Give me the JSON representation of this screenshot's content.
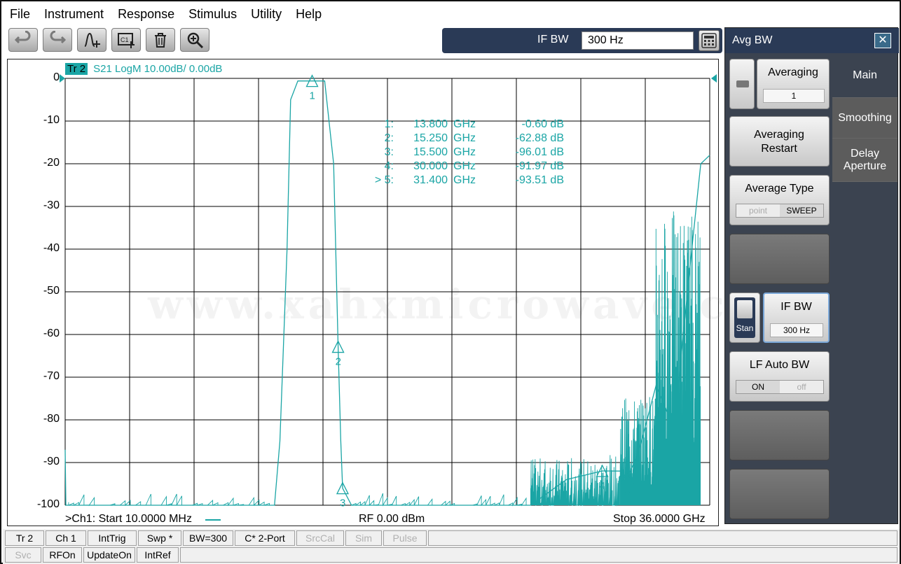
{
  "menu": [
    "File",
    "Instrument",
    "Response",
    "Stimulus",
    "Utility",
    "Help"
  ],
  "toolbar": {
    "ifbw_label": "IF BW",
    "ifbw_value": "300 Hz"
  },
  "plot": {
    "trace_badge": "Tr 2",
    "trace_desc": "S21 LogM 10.00dB/  0.00dB",
    "y_ticks": [
      "0",
      "-10",
      "-20",
      "-30",
      "-40",
      "-50",
      "-60",
      "-70",
      "-80",
      "-90",
      "-100"
    ],
    "markers": [
      {
        "id": "1:",
        "freq": "13.800",
        "unit": "GHz",
        "value": "-0.60 dB"
      },
      {
        "id": "2:",
        "freq": "15.250",
        "unit": "GHz",
        "value": "-62.88 dB"
      },
      {
        "id": "3:",
        "freq": "15.500",
        "unit": "GHz",
        "value": "-96.01 dB"
      },
      {
        "id": "4:",
        "freq": "30.000",
        "unit": "GHz",
        "value": "-91.97 dB"
      },
      {
        "id": "> 5:",
        "freq": "31.400",
        "unit": "GHz",
        "value": "-93.51 dB"
      }
    ],
    "marker_labels": [
      "1",
      "2",
      "3",
      "4",
      "5"
    ],
    "channel_number": "1",
    "start_text": ">Ch1:  Start   10.0000 MHz",
    "rf_text": "RF     0.00 dBm",
    "stop_text": "Stop  36.0000 GHz",
    "watermark": "www.xahxmicrowave.com",
    "trace_color": "#1aa5a5"
  },
  "chart_data": {
    "type": "line",
    "xlabel": "",
    "ylabel": "",
    "xlim": [
      0.01,
      36.0
    ],
    "ylim": [
      -100,
      0
    ],
    "series": [
      {
        "name": "S21",
        "x": [
          0.01,
          0.05,
          1.0,
          5.0,
          10.0,
          11.7,
          12.0,
          12.4,
          12.6,
          13.0,
          13.8,
          14.5,
          15.0,
          15.25,
          15.4,
          15.5,
          16.0,
          20.0,
          26.0,
          28.0,
          30.0,
          31.0,
          31.4,
          32.0,
          33.0,
          34.0,
          35.0,
          35.5,
          36.0
        ],
        "y": [
          -87,
          -100,
          -100,
          -100,
          -100,
          -100,
          -85,
          -40,
          -5,
          -0.6,
          -0.6,
          -0.6,
          -20,
          -62.88,
          -85,
          -96.01,
          -100,
          -100,
          -100,
          -94,
          -91.97,
          -92,
          -93.51,
          -88,
          -72,
          -82,
          -40,
          -20,
          -18
        ]
      }
    ]
  },
  "side": {
    "title": "Avg BW",
    "close": "✕",
    "tabs": [
      "Main",
      "Smoothing",
      "Delay\nAperture"
    ],
    "averaging_label": "Averaging",
    "averaging_value": "1",
    "averaging_restart": "Averaging Restart",
    "average_type_label": "Average Type",
    "average_type_opts": [
      "point",
      "SWEEP"
    ],
    "stan_label": "Stan",
    "ifbw_label": "IF BW",
    "ifbw_value": "300 Hz",
    "lf_auto_label": "LF Auto BW",
    "lf_auto_opts": [
      "ON",
      "off"
    ]
  },
  "status": {
    "row1": [
      "Tr 2",
      "Ch 1",
      "IntTrig",
      "Swp *",
      "BW=300",
      "C* 2-Port",
      "SrcCal",
      "Sim",
      "Pulse"
    ],
    "row2": [
      "Svc",
      "RFOn",
      "UpdateOn",
      "IntRef"
    ]
  }
}
